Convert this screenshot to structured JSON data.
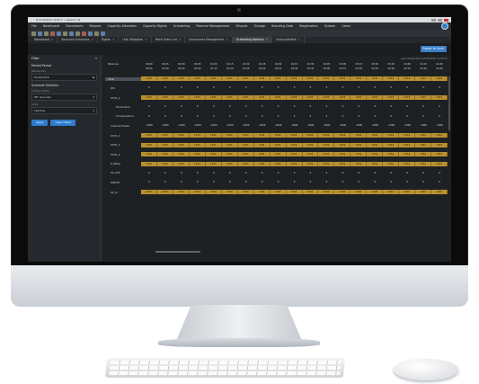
{
  "window": {
    "title": "G Scheduler 2016 1 • Session 01"
  },
  "menu": [
    "File",
    "Dashboard",
    "Documents",
    "Reports",
    "Capacity Allocation",
    "Capacity Rights",
    "Scheduling",
    "Reserve Management",
    "Dispute",
    "Outage",
    "Standing Data",
    "Registration",
    "System",
    "Users"
  ],
  "tabs": [
    {
      "label": "Dashboard",
      "active": false
    },
    {
      "label": "Resource Schedules",
      "active": false
    },
    {
      "label": "Rights",
      "active": false
    },
    {
      "label": "Unit Utilization",
      "active": false
    },
    {
      "label": "Merit Order List",
      "active": false
    },
    {
      "label": "Documents Management",
      "active": false
    },
    {
      "label": "Scheduling Balance",
      "active": true
    },
    {
      "label": "Surplus/Deficit",
      "active": false
    }
  ],
  "actions": {
    "export_label": "Export to Excel"
  },
  "filter": {
    "title": "Filter",
    "collapse_icon": "double-chevron-left",
    "sections": {
      "market_period": "Market Period",
      "schedule_selection": "Schedule Selection"
    },
    "fields": {
      "market_day_label": "Market Day",
      "market_day_value": "01/05/2016",
      "contract_party_label": "Contract Party",
      "contract_party_value": "INT (Luanda)",
      "units_label": "Units",
      "units_value": "100 files"
    },
    "buttons": {
      "apply": "Apply",
      "clear": "Clear Filters"
    }
  },
  "grid": {
    "last_refresh": "Last refresh time 01/05/2016 11:05:57",
    "balance_header": "Balance",
    "time_from": [
      "00:00",
      "00:15",
      "00:30",
      "00:45",
      "01:00",
      "01:15",
      "01:30",
      "01:45",
      "02:00",
      "02:15",
      "02:30",
      "02:45",
      "03:00",
      "03:15",
      "03:30",
      "03:45",
      "04:00",
      "04:15",
      "04:30"
    ],
    "time_to": [
      "00:15",
      "00:30",
      "00:45",
      "01:00",
      "01:15",
      "01:30",
      "01:45",
      "02:00",
      "02:15",
      "02:30",
      "02:45",
      "03:00",
      "03:15",
      "03:30",
      "03:45",
      "04:00",
      "04:15",
      "04:30",
      "04:45"
    ],
    "rows": [
      {
        "label": "Total",
        "style": "hl",
        "gold": true,
        "value": "1234"
      },
      {
        "label": "DIS",
        "style": "sub",
        "gold": false,
        "value": "0"
      },
      {
        "label": "STOI_1",
        "style": "sub",
        "gold": true,
        "value": "1234"
      },
      {
        "label": "Production",
        "style": "ul",
        "gold": false,
        "value": "0"
      },
      {
        "label": "Consumption",
        "style": "ul",
        "gold": false,
        "value": "0"
      },
      {
        "label": "Interval Trade",
        "style": "sub",
        "gold": false,
        "value": "-1000"
      },
      {
        "label": "STOI_0",
        "style": "sub",
        "gold": true,
        "value": "1234"
      },
      {
        "label": "STOI_1",
        "style": "sub",
        "gold": true,
        "value": "1234"
      },
      {
        "label": "STOI_2",
        "style": "sub",
        "gold": true,
        "value": "1234"
      },
      {
        "label": "P_PROJ",
        "style": "sub",
        "gold": true,
        "value": "1234"
      },
      {
        "label": "SC_ICR",
        "style": "sub",
        "gold": false,
        "value": "0"
      },
      {
        "label": "WIDTH",
        "style": "sub",
        "gold": false,
        "value": "0"
      },
      {
        "label": "SC_R",
        "style": "sub",
        "gold": true,
        "value": "1234"
      }
    ]
  },
  "colors": {
    "accent": "#2f7bcd",
    "gold": "#b8912f",
    "bg": "#202327"
  }
}
